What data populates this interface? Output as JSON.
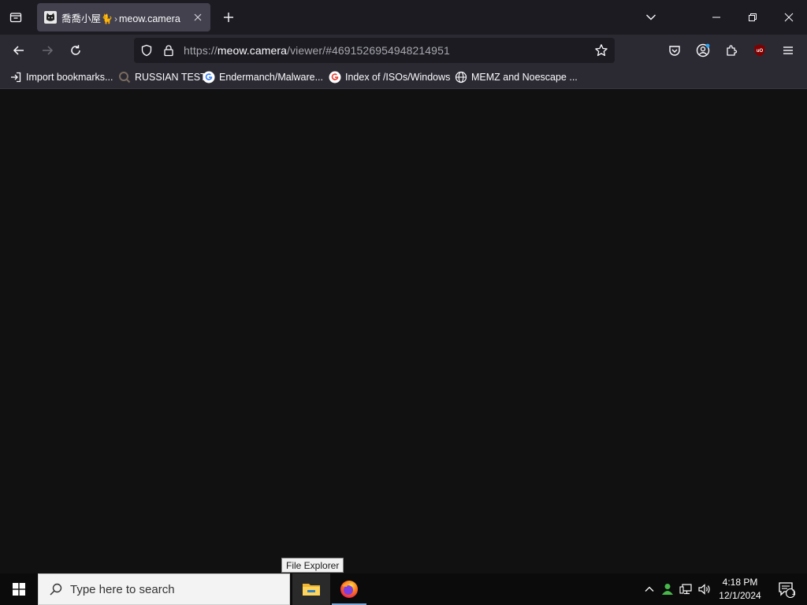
{
  "browser": {
    "tab": {
      "title": "喬喬小屋",
      "separator": "›",
      "site": "meow.camera",
      "close_glyph": "✕"
    },
    "url": {
      "scheme": "https://",
      "host": "meow.camera",
      "path": "/viewer/#4691526954948214951"
    },
    "bookmarks": [
      {
        "label": "Import bookmarks...",
        "icon": "import-icon"
      },
      {
        "label": "RUSSIAN TEST",
        "icon": "magnifier-icon"
      },
      {
        "label": "Endermanch/Malware...",
        "icon": "google-icon"
      },
      {
        "label": "Index of /ISOs/Windows",
        "icon": "google-icon"
      },
      {
        "label": "MEMZ and Noescape ...",
        "icon": "globe-icon"
      }
    ],
    "toolbar_icons": [
      "pocket-icon",
      "account-icon",
      "extensions-icon",
      "ublock-icon",
      "menu-icon"
    ],
    "colors": {
      "tabstrip": "#1c1b22",
      "toolbar": "#2b2a33",
      "selected_tab": "#42414d",
      "content": "#111111"
    }
  },
  "tooltip": {
    "text": "File Explorer"
  },
  "taskbar": {
    "search_placeholder": "Type here to search",
    "apps": [
      "file-explorer-icon",
      "firefox-icon"
    ],
    "tray": [
      "chevron-up-icon",
      "user-status-icon",
      "network-icon",
      "volume-icon"
    ],
    "time": "4:18 PM",
    "date": "12/1/2024",
    "notification_count": "1"
  }
}
